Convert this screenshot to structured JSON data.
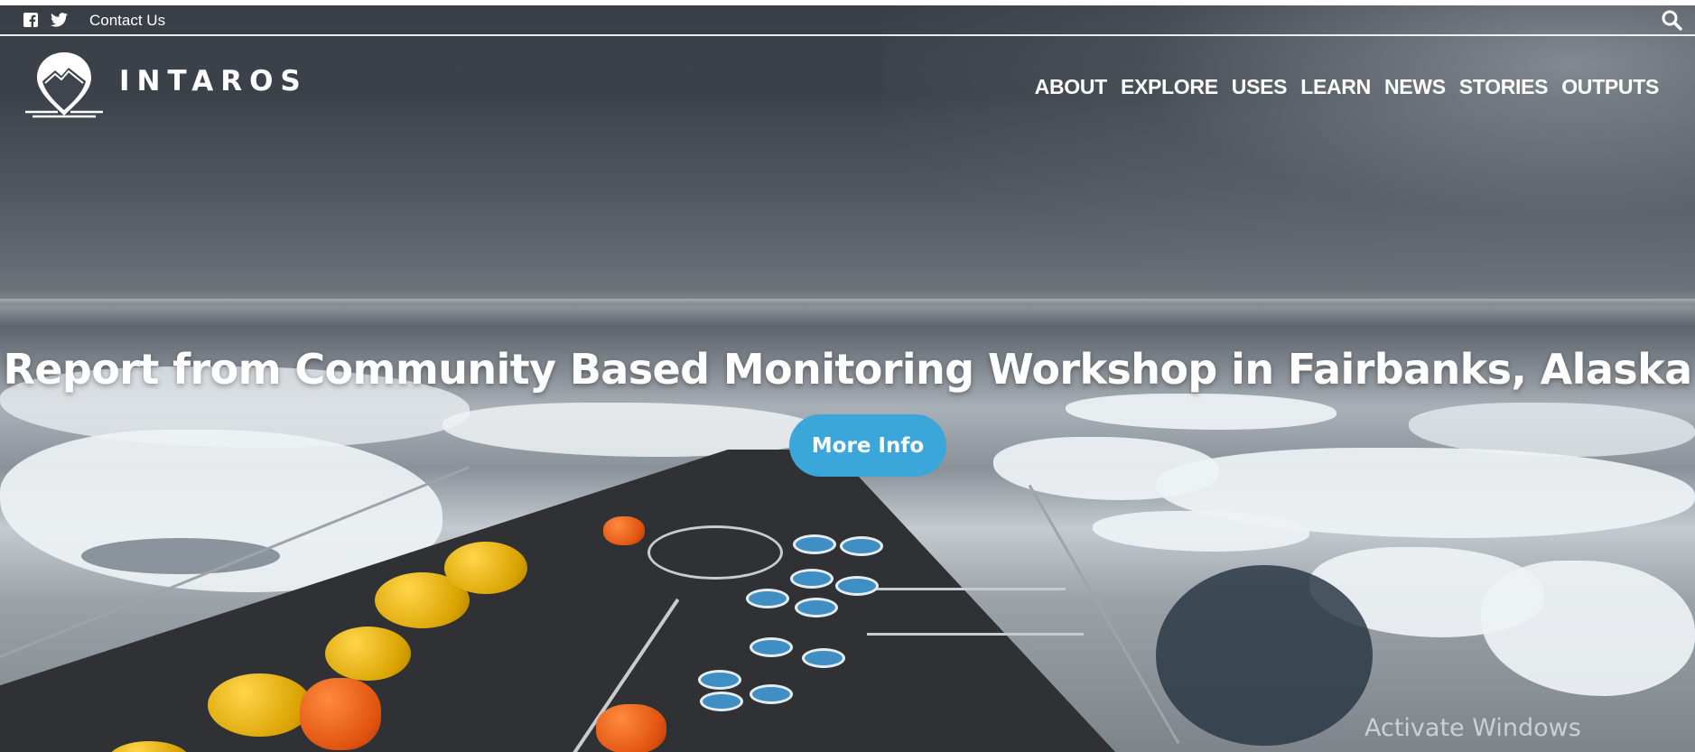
{
  "topbar": {
    "icons": [
      "facebook-icon",
      "twitter-icon",
      "search-icon"
    ],
    "contact_label": "Contact Us"
  },
  "brand": {
    "name": "INTAROS",
    "icon": "location-pin-mountain-logo"
  },
  "nav": {
    "items": [
      {
        "label": "ABOUT"
      },
      {
        "label": "EXPLORE"
      },
      {
        "label": "USES"
      },
      {
        "label": "LEARN"
      },
      {
        "label": "NEWS"
      },
      {
        "label": "STORIES"
      },
      {
        "label": "OUTPUTS"
      }
    ]
  },
  "hero": {
    "headline": "Report from Community Based Monitoring Workshop in Fairbanks, Alaska",
    "cta_label": "More Info",
    "accent_color": "#3aa6d9"
  },
  "system": {
    "watermark": "Activate Windows"
  }
}
